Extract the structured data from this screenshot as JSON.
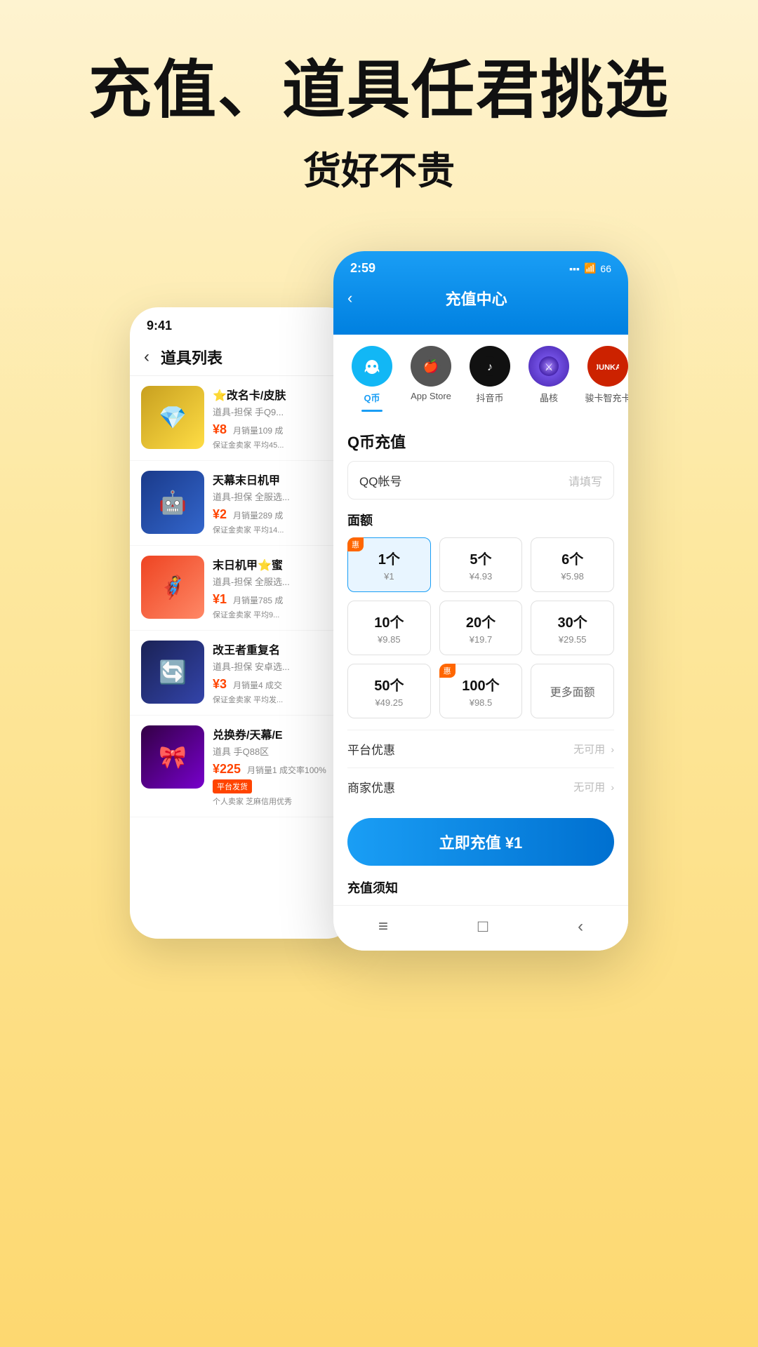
{
  "hero": {
    "title": "充值、道具任君挑选",
    "subtitle": "货好不贵"
  },
  "left_phone": {
    "status_time": "9:41",
    "header_title": "道具列表",
    "back_label": "‹",
    "items": [
      {
        "name": "⭐改名卡/皮肤",
        "desc": "道具-担保 手Q9...",
        "price": "¥8",
        "sales": "月销量109成",
        "guarantee": "保证金卖家 平均45...",
        "color": "#c8a020",
        "emoji": "💎"
      },
      {
        "name": "天幕末日机甲",
        "desc": "道具-担保 全服选...",
        "price": "¥2",
        "sales": "月销量289成",
        "guarantee": "保证金卖家 平均14...",
        "color": "#2244aa",
        "emoji": "🤖"
      },
      {
        "name": "末日机甲⭐蜜",
        "desc": "道具-担保 全服选...",
        "price": "¥1",
        "sales": "月销量785 成",
        "guarantee": "保证金卖家 平均9...",
        "color": "#ff6644",
        "emoji": "🦸"
      },
      {
        "name": "改王者重复名",
        "desc": "道具-担保 安卓选...",
        "price": "¥3",
        "sales": "月销量4 成交",
        "guarantee": "保证金卖家 平均发...",
        "color": "#223366",
        "emoji": "🔄"
      },
      {
        "name": "兑换券/天幕/E",
        "desc": "道具 手Q88区",
        "price": "¥225",
        "sales": "月销量1 成交率100%",
        "guarantee": "",
        "platform_tag": "平台发货",
        "extra": "个人卖家 芝麻信用优秀",
        "color": "#ff88bb",
        "emoji": "🎀"
      }
    ]
  },
  "right_phone": {
    "status_time": "2:59",
    "back_label": "‹",
    "title": "充值中心",
    "categories": [
      {
        "id": "qq",
        "label": "Q币",
        "active": true,
        "emoji": "🐧",
        "color": "#12b7f5"
      },
      {
        "id": "apple",
        "label": "App Store",
        "active": false,
        "emoji": "🍎",
        "color": "#555"
      },
      {
        "id": "douyin",
        "label": "抖音币",
        "active": false,
        "emoji": "♪",
        "color": "#111"
      },
      {
        "id": "jinghe",
        "label": "晶核",
        "active": false,
        "emoji": "💫",
        "color": "#6644cc"
      },
      {
        "id": "junka",
        "label": "骏卡智充卡",
        "active": false,
        "emoji": "🃏",
        "color": "#cc2200"
      }
    ],
    "section_title": "Q币充值",
    "qq_input": {
      "label": "QQ帐号",
      "placeholder": "请填写"
    },
    "denomination_title": "面额",
    "denominations": [
      {
        "qty": "1个",
        "price": "¥1",
        "selected": true,
        "tag": "惠"
      },
      {
        "qty": "5个",
        "price": "¥4.93",
        "selected": false,
        "tag": ""
      },
      {
        "qty": "6个",
        "price": "¥5.98",
        "selected": false,
        "tag": ""
      },
      {
        "qty": "10个",
        "price": "¥9.85",
        "selected": false,
        "tag": ""
      },
      {
        "qty": "20个",
        "price": "¥19.7",
        "selected": false,
        "tag": ""
      },
      {
        "qty": "30个",
        "price": "¥29.55",
        "selected": false,
        "tag": ""
      },
      {
        "qty": "50个",
        "price": "¥49.25",
        "selected": false,
        "tag": ""
      },
      {
        "qty": "100个",
        "price": "¥98.5",
        "selected": false,
        "tag": "惠"
      },
      {
        "qty": "更多面额",
        "price": "",
        "selected": false,
        "tag": "",
        "is_more": true
      }
    ],
    "platform_discount": {
      "label": "平台优惠",
      "value": "无可用"
    },
    "merchant_discount": {
      "label": "商家优惠",
      "value": "无可用"
    },
    "charge_button": "立即充值 ¥1",
    "notice_title": "充值须知",
    "nav": [
      "≡",
      "□",
      "‹"
    ]
  }
}
